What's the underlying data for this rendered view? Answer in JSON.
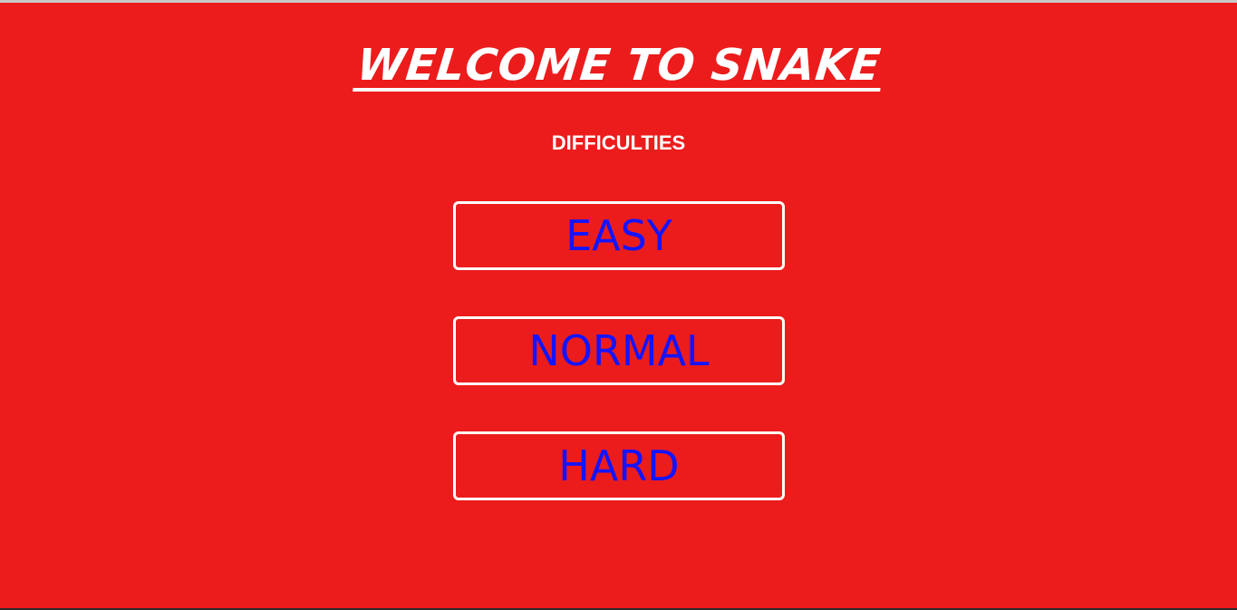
{
  "game": {
    "title": "WELCOME TO SNAKE",
    "subtitle": "DIFFICULTIES",
    "buttons": {
      "easy": "EASY",
      "normal": "NORMAL",
      "hard": "HARD"
    }
  },
  "colors": {
    "background": "#ec1c1c",
    "text_primary": "#ffffff",
    "button_text": "#1414ff",
    "button_border": "#ffffff"
  }
}
